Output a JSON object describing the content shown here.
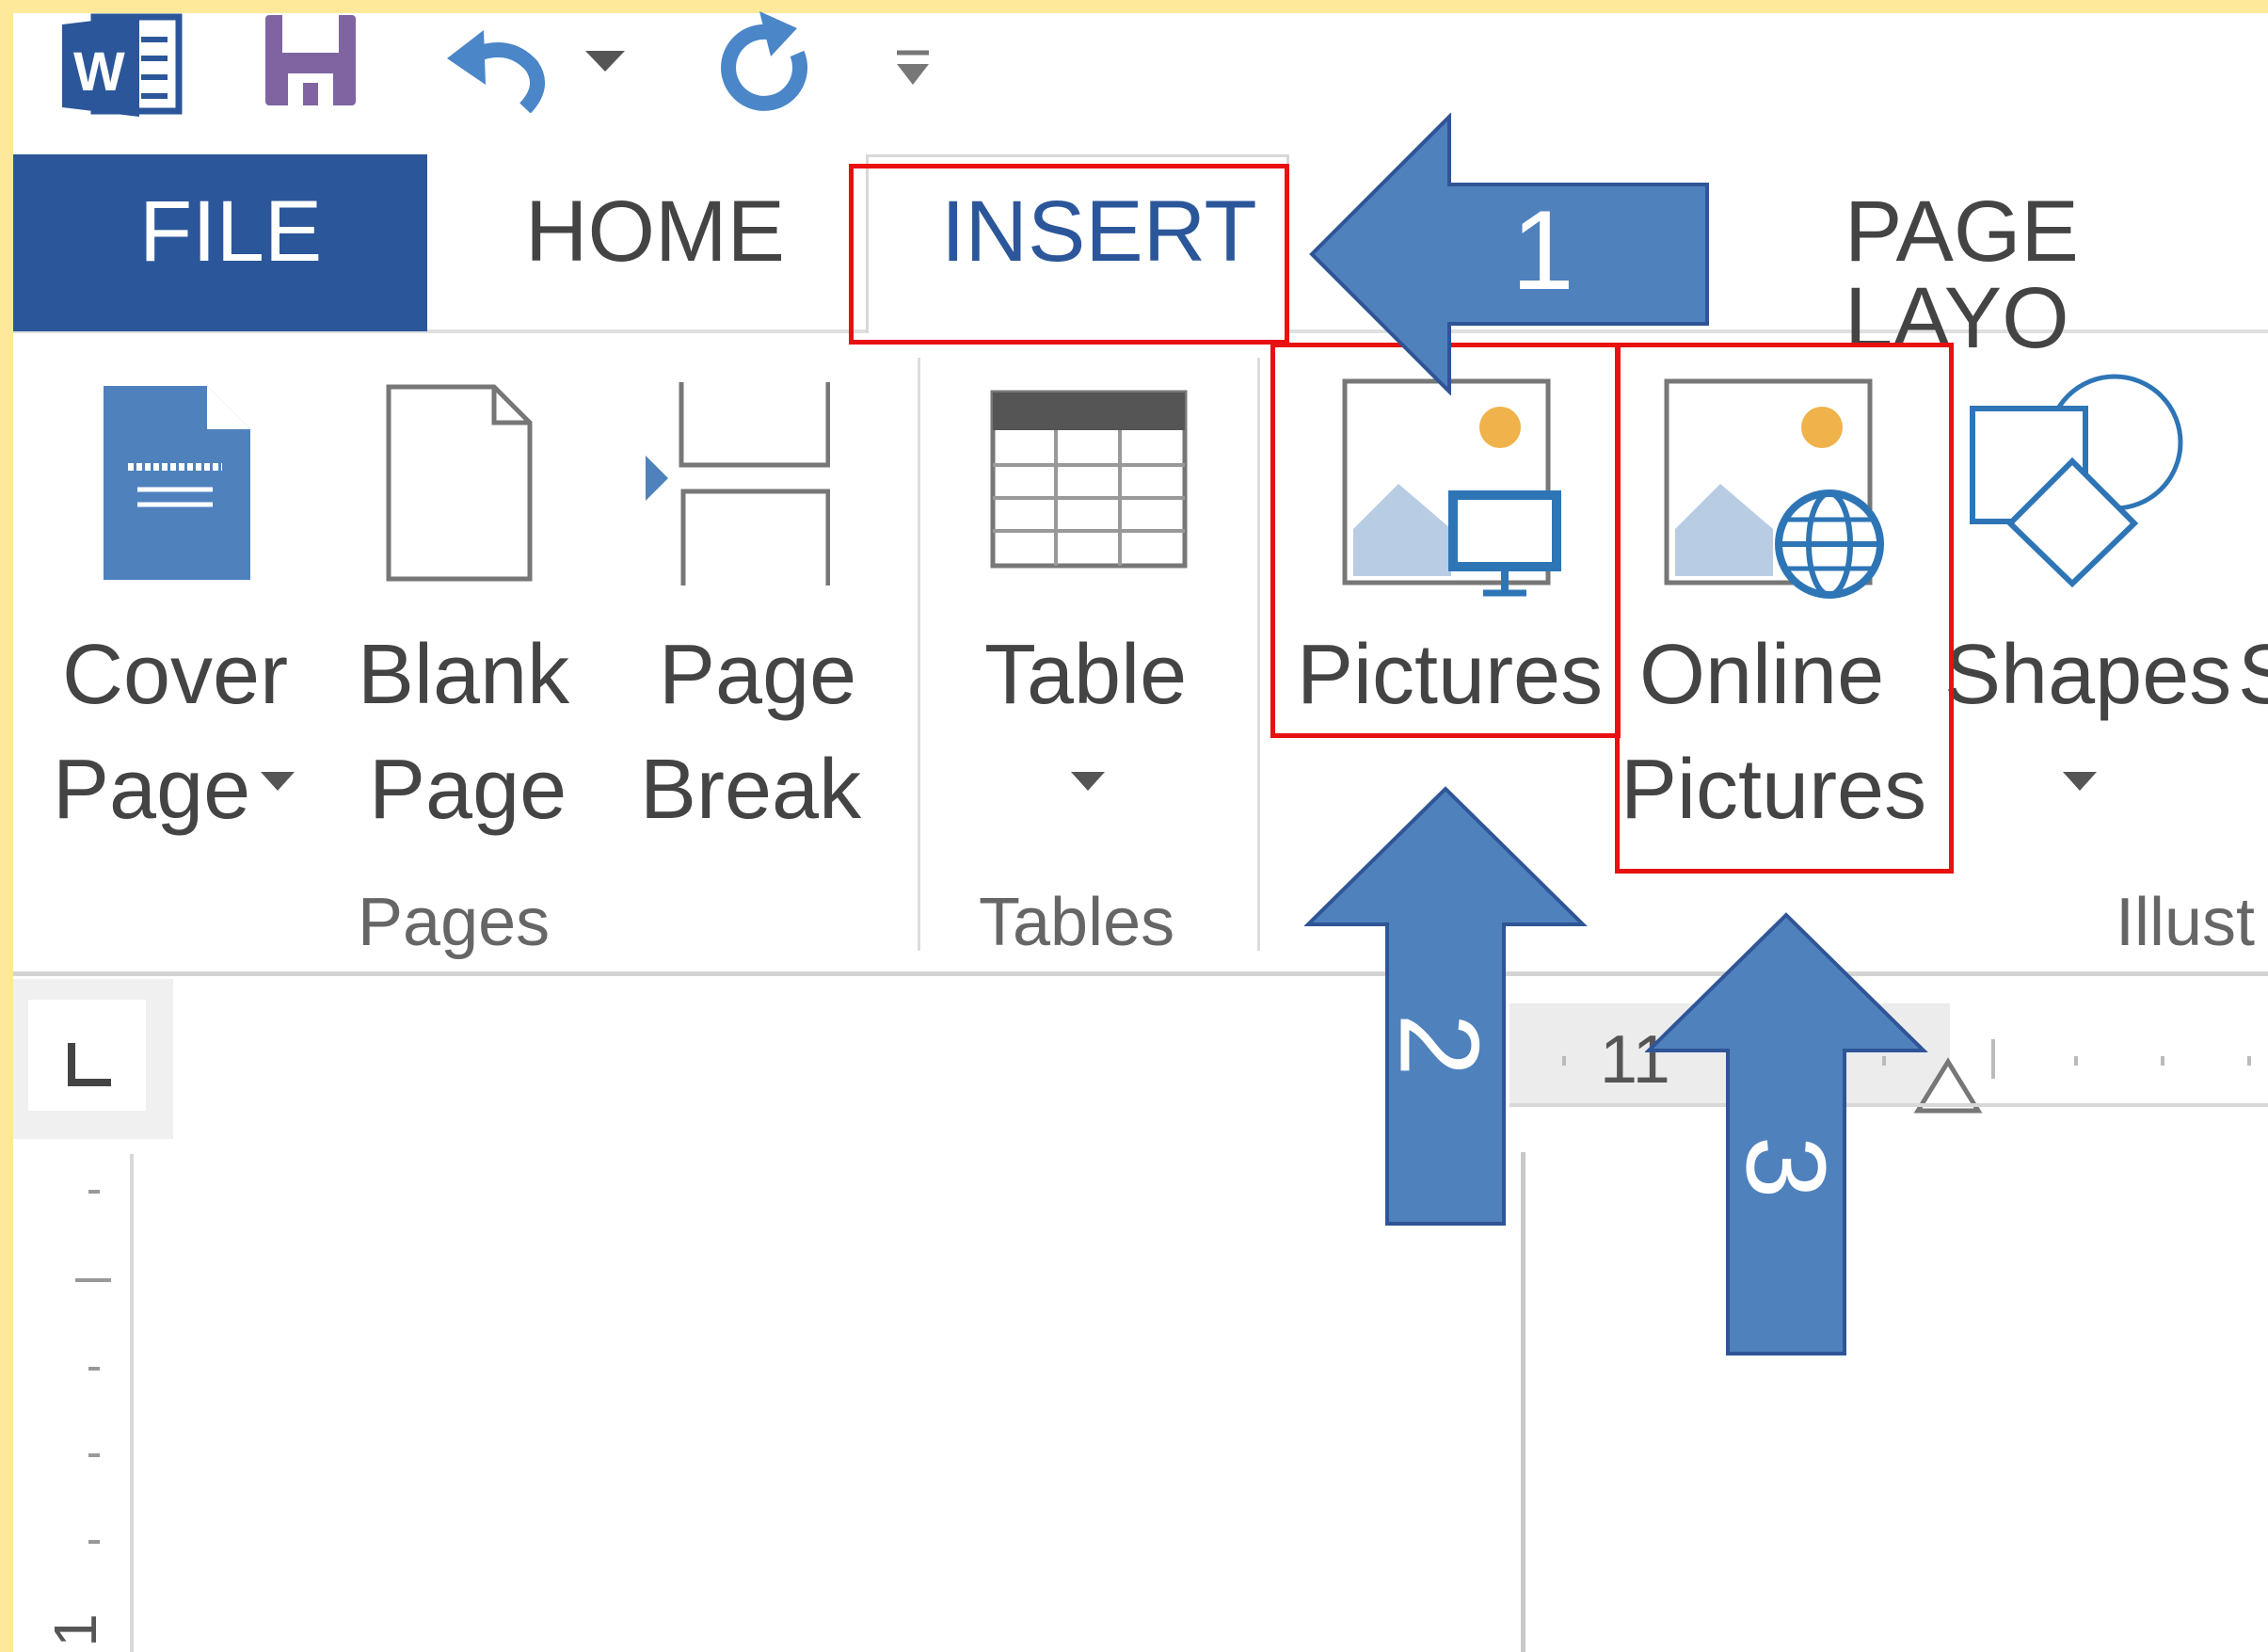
{
  "tabs": {
    "file": "FILE",
    "home": "HOME",
    "insert": "INSERT",
    "page_layout": "PAGE LAYO"
  },
  "ribbon": {
    "cover_page": [
      "Cover",
      "Page"
    ],
    "blank_page": [
      "Blank",
      "Page"
    ],
    "page_break": [
      "Page",
      "Break"
    ],
    "table": "Table",
    "pictures": "Pictures",
    "online_pictures": [
      "Online",
      "Pictures"
    ],
    "shapes": "Shapes",
    "partial_next": "S",
    "groups": {
      "pages": "Pages",
      "tables": "Tables",
      "illustrations": "Illust"
    }
  },
  "annotations": {
    "step1": "1",
    "step2": "2",
    "step3": "3"
  },
  "ruler": {
    "marker": "11",
    "vertical_marker": "1"
  },
  "colors": {
    "frame": "#fee89a",
    "file_tab": "#2b579a",
    "insert_text": "#2b579a",
    "highlight": "#e81010",
    "arrow": "#4f81bd"
  },
  "icons": [
    "word-logo-icon",
    "save-icon",
    "undo-icon",
    "redo-icon",
    "customize-qat-icon"
  ]
}
